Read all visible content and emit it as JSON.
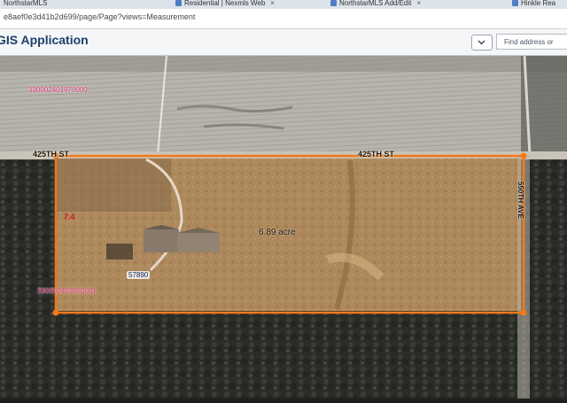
{
  "browser": {
    "tabs": [
      {
        "label": "NorthstarMLS"
      },
      {
        "label": "Residential | Nexmls Web",
        "close": "×"
      },
      {
        "label": "NorthstarMLS Add/Edit",
        "close": "×"
      },
      {
        "label": "Hinkle Rea"
      }
    ],
    "url": "e8aef0e3d41b2d699/page/Page?views=Measurement"
  },
  "app": {
    "title": "GIS Application",
    "search_placeholder": "Find address or"
  },
  "map": {
    "labels": {
      "street_west": "425TH ST",
      "street_east": "425TH ST",
      "street_side": "550TH AVE",
      "pid_north": "330002401970000",
      "pid_parcel": "330002403580001",
      "area": "6.89 acre",
      "address_number": "57890",
      "parcel_marker": "7.4"
    },
    "colors": {
      "measure_outline": "#f07a1c",
      "pid_text": "#e03a7a"
    }
  }
}
